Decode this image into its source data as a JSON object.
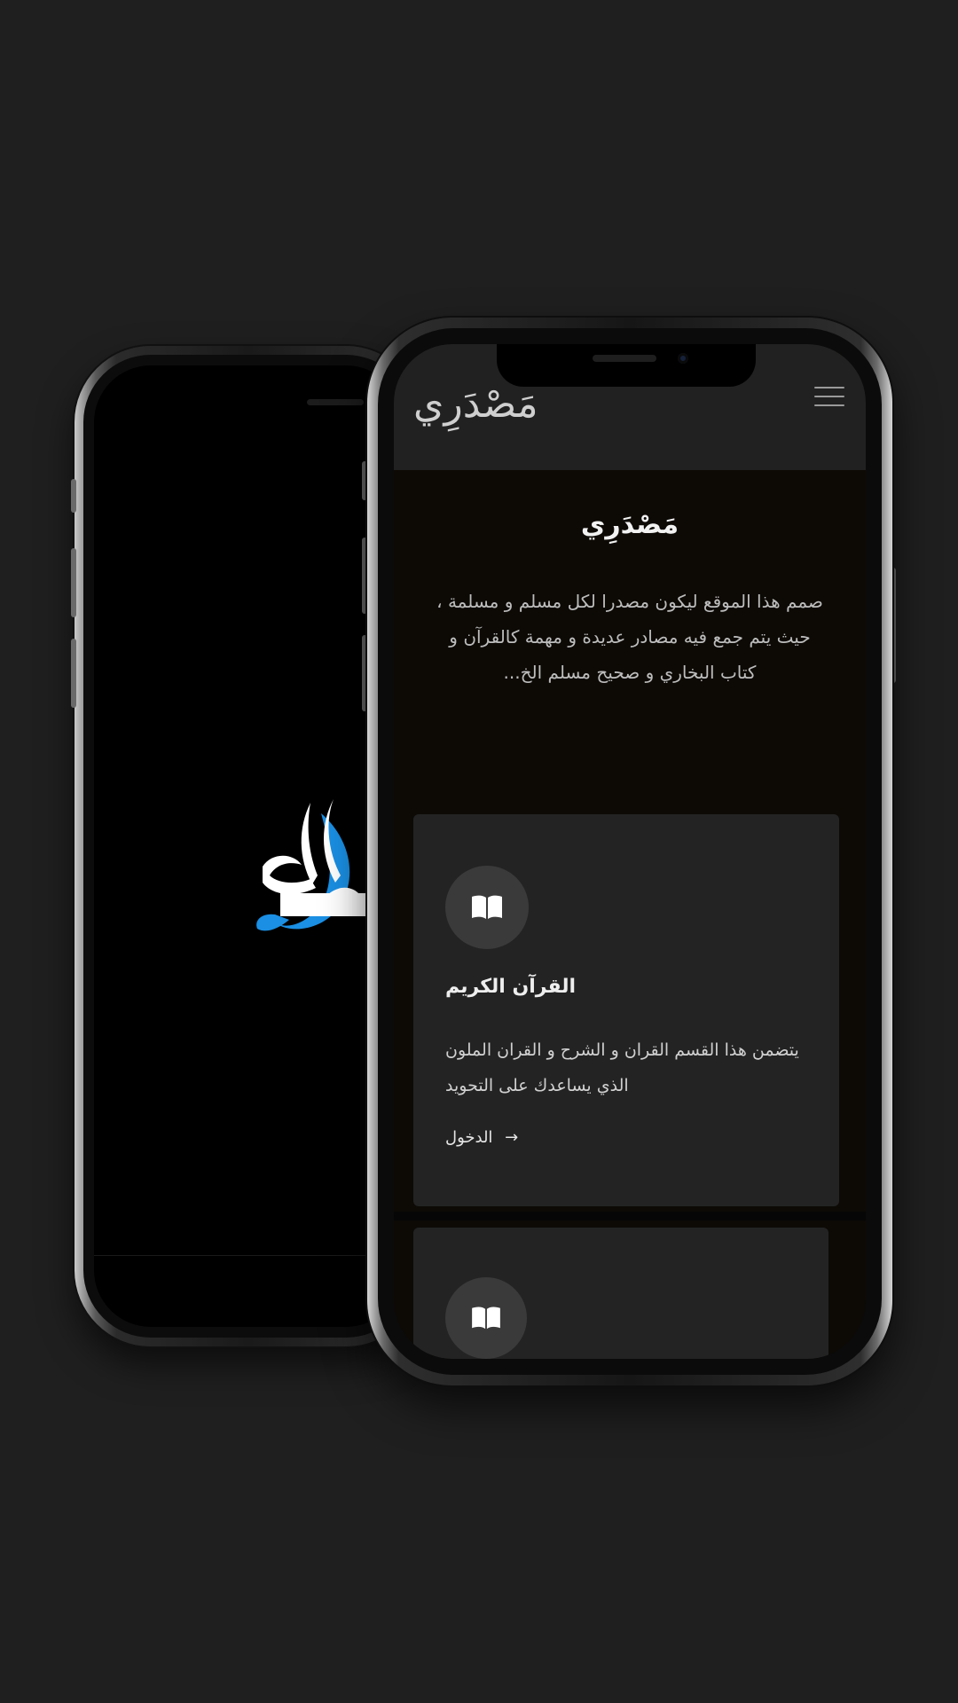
{
  "brand": {
    "name": "مَصْدَرِي"
  },
  "hero": {
    "title": "مَصْدَرِي",
    "description": "صمم هذا الموقع ليكون مصدرا لكل مسلم و مسلمة ، حيث يتم جمع فيه مصادر عديدة و مهمة كالقرآن و كتاب البخاري و صحيح مسلم الخ..."
  },
  "cards": [
    {
      "icon": "book-icon",
      "title": "القرآن الكريم",
      "description": "يتضمن هذا القسم القران و الشرح و القران الملون الذي يساعدك على التحويد",
      "link_label": "الدخول",
      "link_arrow": "→"
    },
    {
      "icon": "book-icon"
    }
  ],
  "colors": {
    "background": "#1f1f1f",
    "topbar": "#212121",
    "card": "#232323",
    "accent_blue": "#1a8fe3"
  }
}
